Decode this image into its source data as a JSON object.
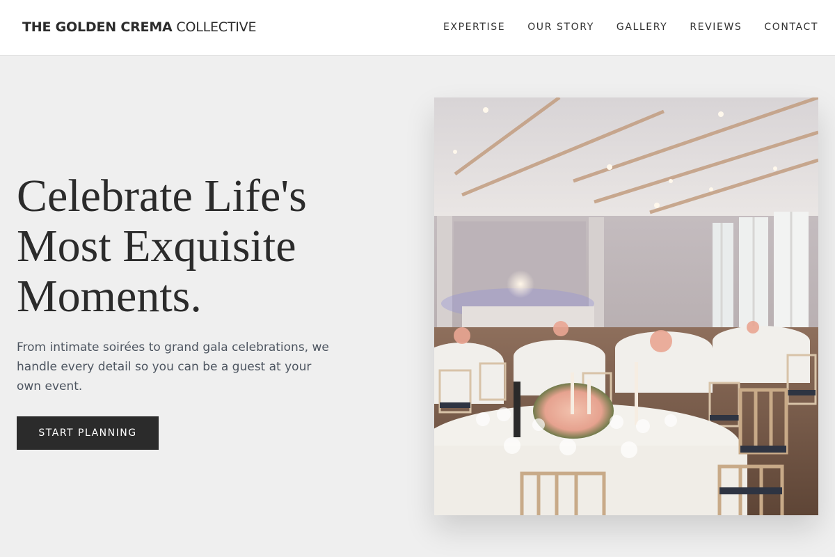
{
  "header": {
    "brand_bold": "THE GOLDEN CREMA",
    "brand_light": "COLLECTIVE",
    "nav": [
      {
        "label": "EXPERTISE"
      },
      {
        "label": "OUR STORY"
      },
      {
        "label": "GALLERY"
      },
      {
        "label": "REVIEWS"
      },
      {
        "label": "CONTACT"
      }
    ]
  },
  "hero": {
    "title_line1": "Celebrate Life's",
    "title_line2": "Most Exquisite",
    "title_line3": "Moments.",
    "subtitle": "From intimate soirées to grand gala celebrations, we handle every detail so you can be a guest at your own event.",
    "cta_label": "START PLANNING"
  },
  "colors": {
    "page_bg": "#efefef",
    "header_bg": "#ffffff",
    "text_dark": "#2b2b2b",
    "cta_bg": "#2b2b2b"
  }
}
